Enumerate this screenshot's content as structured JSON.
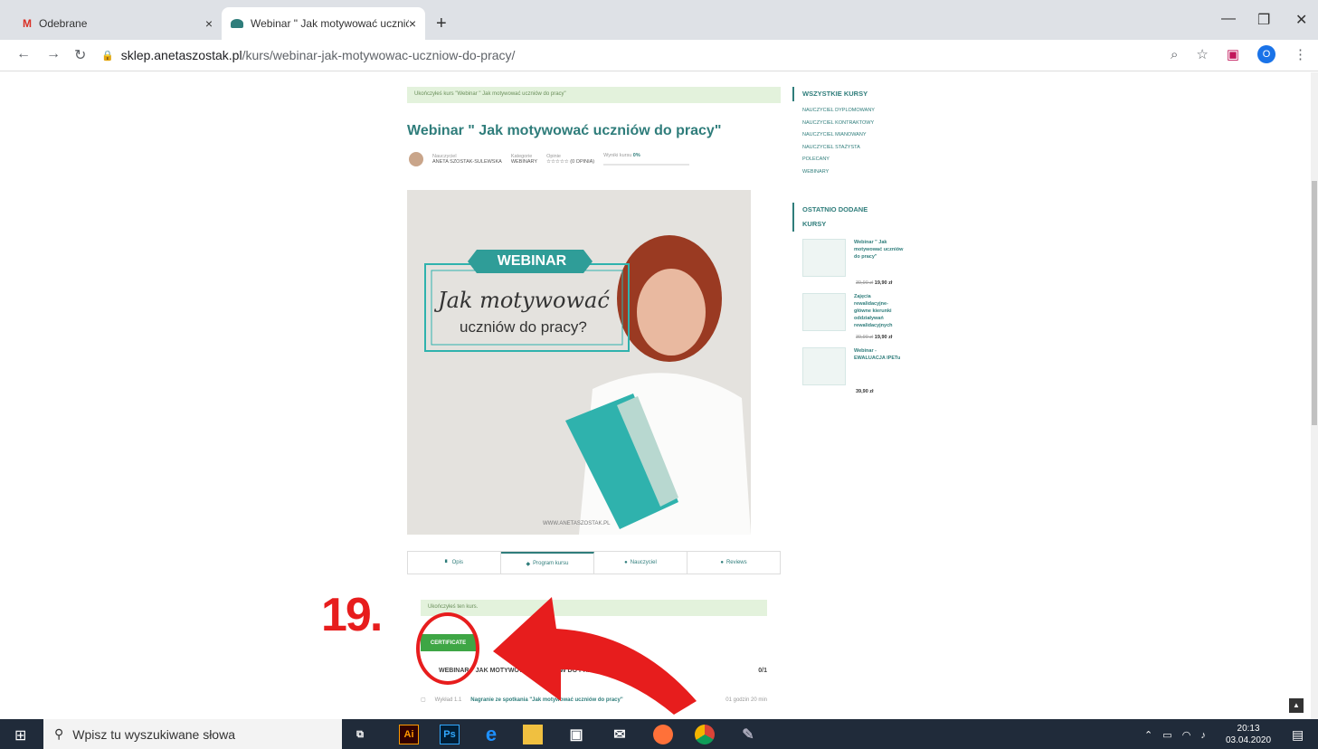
{
  "browser": {
    "tabs": [
      {
        "title": "Odebrane"
      },
      {
        "title": "Webinar \" Jak motywować uczniów"
      }
    ],
    "close_glyph": "×",
    "new_tab_glyph": "+",
    "url_host": "sklep.anetaszostak.pl",
    "url_path": "/kurs/webinar-jak-motywowac-uczniow-do-pracy/",
    "profile_initial": "O"
  },
  "page": {
    "notice": "Ukończyłeś kurs \"Webinar \" Jak motywować uczniów do pracy\"",
    "title": "Webinar \" Jak motywować uczniów do pracy\"",
    "meta": {
      "teacher_label": "Nauczyciel",
      "teacher": "ANETA SZOSTAK-SULEWSKA",
      "category_label": "Kategorie",
      "category": "WEBINARY",
      "reviews_label": "Opinie",
      "reviews": "☆☆☆☆☆ (0 OPINIA)",
      "results_label": "Wyniki kursu",
      "results_value": "0%"
    },
    "image": {
      "banner": "WEBINAR",
      "line1": "Jak motywować",
      "line2": "uczniów do pracy?",
      "footer": "WWW.ANETASZOSTAK.PL"
    },
    "tabs": [
      "Opis",
      "Program kursu",
      "Nauczyciel",
      "Reviews"
    ],
    "completed": "Ukończyłeś ten kurs.",
    "certificate": "CERTIFICATE",
    "section": {
      "title": "WEBINAR \" JAK MOTYWOWAĆ UCZNIÓW DO PRACY\"",
      "count": "0/1"
    },
    "lecture": {
      "type": "Wykład 1.1",
      "name": "Nagranie ze spotkania \"Jak motywować uczniów do pracy\"",
      "duration": "01 godzin 20 min"
    }
  },
  "sidebar": {
    "all_heading": "WSZYSTKIE KURSY",
    "categories": [
      "NAUCZYCIEL DYPLOMOWANY",
      "NAUCZYCIEL KONTRAKTOWY",
      "NAUCZYCIEL MIANOWANY",
      "NAUCZYCIEL STAŻYSTA",
      "POLECANY",
      "WEBINARY"
    ],
    "recent_heading": "OSTATNIO DODANE KURSY",
    "recent": [
      {
        "title": "Webinar \" Jak motywować uczniów do pracy\"",
        "old": "39,90 zł",
        "price": "19,90 zł"
      },
      {
        "title": "Zajęcia rewalidacyjne- główne kierunki oddziaływań rewalidacyjnych",
        "old": "39,90 zł",
        "price": "19,90 zł"
      },
      {
        "title": "Webinar - EWALUACJA IPETu",
        "old": "",
        "price": "39,90 zł"
      }
    ]
  },
  "annotation": {
    "label": "19."
  },
  "taskbar": {
    "search_placeholder": "Wpisz tu wyszukiwane słowa",
    "time": "20:13",
    "date": "03.04.2020"
  },
  "colors": {
    "accent": "#2f7d7b",
    "cert": "#3ea645",
    "annotation": "#e71d1d"
  }
}
